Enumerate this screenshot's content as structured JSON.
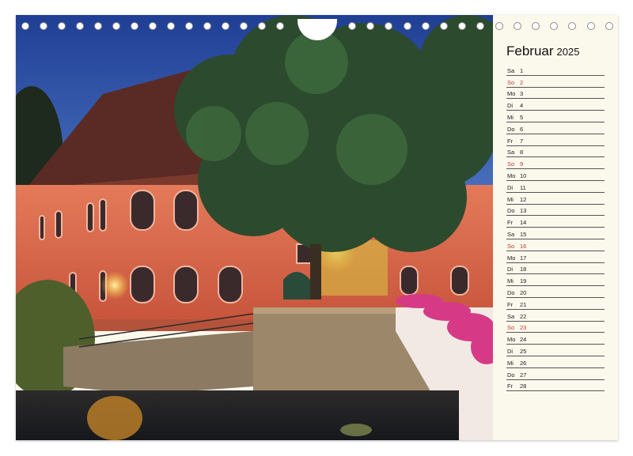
{
  "calendar": {
    "month": "Februar",
    "year": "2025",
    "days": [
      {
        "dn": "Sa",
        "d": "1",
        "sun": false
      },
      {
        "dn": "So",
        "d": "2",
        "sun": true
      },
      {
        "dn": "Mo",
        "d": "3",
        "sun": false
      },
      {
        "dn": "Di",
        "d": "4",
        "sun": false
      },
      {
        "dn": "Mi",
        "d": "5",
        "sun": false
      },
      {
        "dn": "Do",
        "d": "6",
        "sun": false
      },
      {
        "dn": "Fr",
        "d": "7",
        "sun": false
      },
      {
        "dn": "Sa",
        "d": "8",
        "sun": false
      },
      {
        "dn": "So",
        "d": "9",
        "sun": true
      },
      {
        "dn": "Mo",
        "d": "10",
        "sun": false
      },
      {
        "dn": "Di",
        "d": "11",
        "sun": false
      },
      {
        "dn": "Mi",
        "d": "12",
        "sun": false
      },
      {
        "dn": "Do",
        "d": "13",
        "sun": false
      },
      {
        "dn": "Fr",
        "d": "14",
        "sun": false
      },
      {
        "dn": "Sa",
        "d": "15",
        "sun": false
      },
      {
        "dn": "So",
        "d": "16",
        "sun": true
      },
      {
        "dn": "Mo",
        "d": "17",
        "sun": false
      },
      {
        "dn": "Di",
        "d": "18",
        "sun": false
      },
      {
        "dn": "Mi",
        "d": "19",
        "sun": false
      },
      {
        "dn": "Do",
        "d": "20",
        "sun": false
      },
      {
        "dn": "Fr",
        "d": "21",
        "sun": false
      },
      {
        "dn": "Sa",
        "d": "22",
        "sun": false
      },
      {
        "dn": "So",
        "d": "23",
        "sun": true
      },
      {
        "dn": "Mo",
        "d": "24",
        "sun": false
      },
      {
        "dn": "Di",
        "d": "25",
        "sun": false
      },
      {
        "dn": "Mi",
        "d": "26",
        "sun": false
      },
      {
        "dn": "Do",
        "d": "27",
        "sun": false
      },
      {
        "dn": "Fr",
        "d": "28",
        "sun": false
      }
    ]
  },
  "colors": {
    "sunday": "#c0392b",
    "panel": "#fbf8ec",
    "sky": "#2a4a9a",
    "building": "#d8684a"
  },
  "photo": {
    "subject": "photo-evening-riverside-building"
  }
}
